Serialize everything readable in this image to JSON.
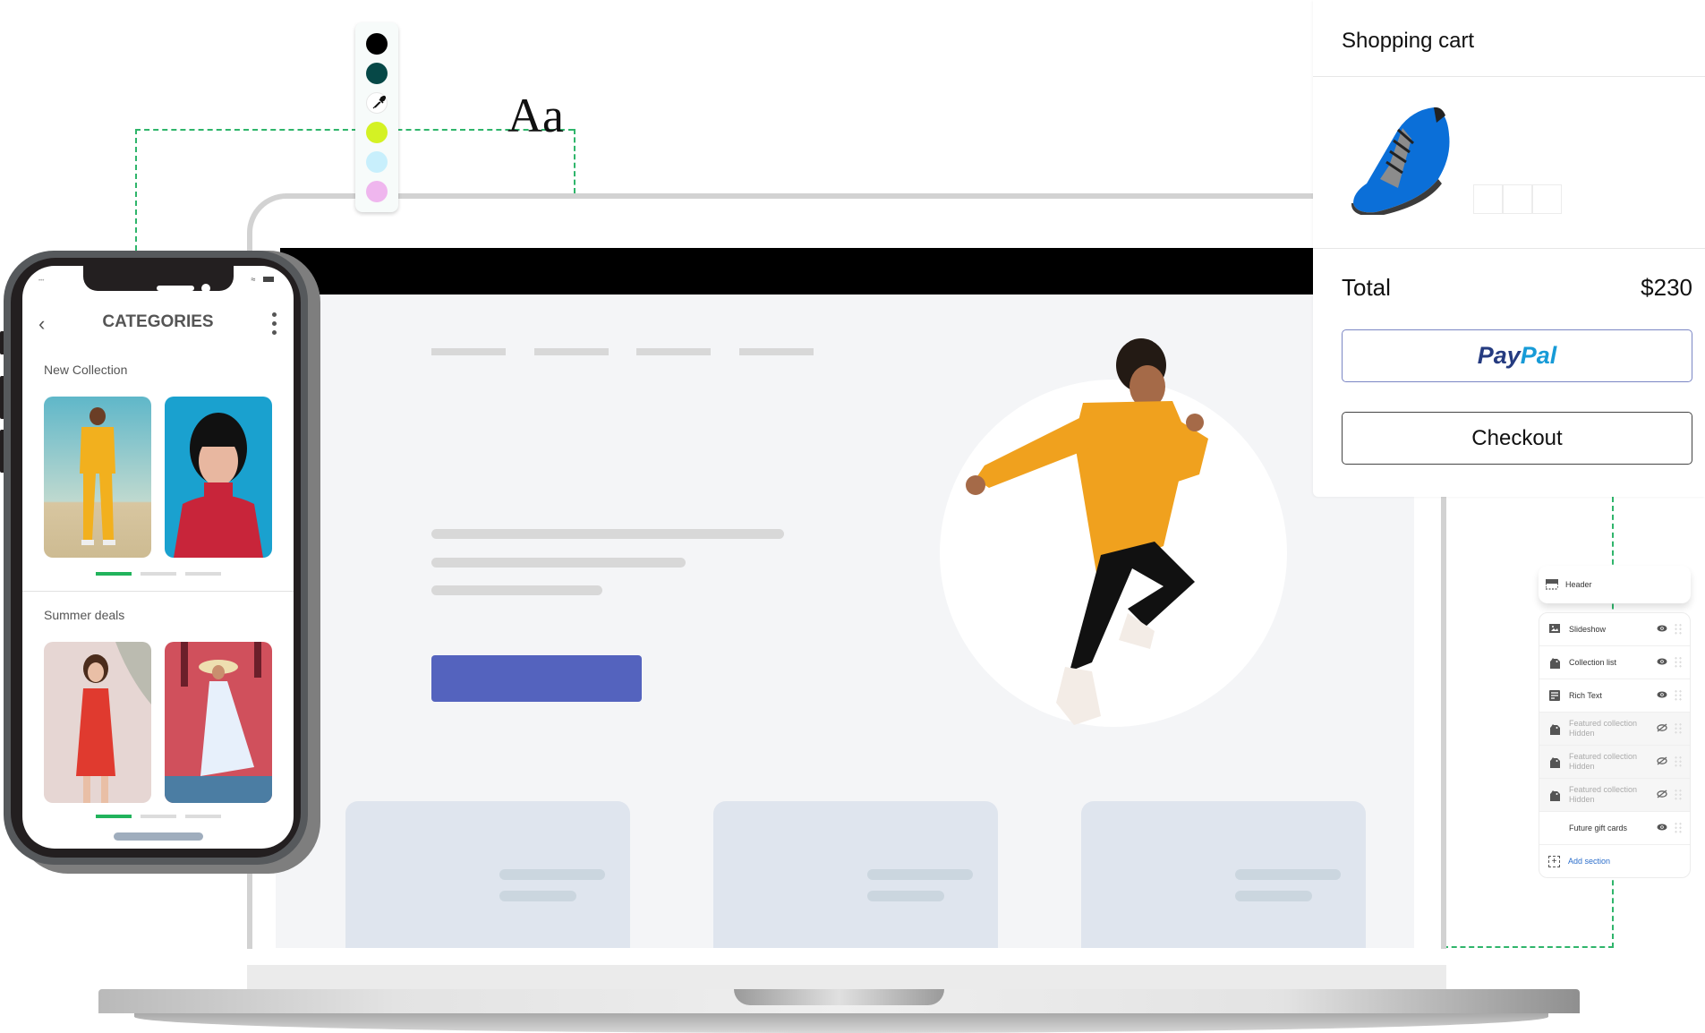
{
  "palette": {
    "colors": [
      "#000000",
      "#064847",
      "#ffffff",
      "#d4f224",
      "#c8effc",
      "#efb6ee"
    ],
    "eyedropper_icon": "eyedropper-icon",
    "typography_sample": "Aa"
  },
  "phone": {
    "title": "CATEGORIES",
    "back_icon": "chevron-left-icon",
    "more_icon": "more-vertical-icon",
    "status_icons": [
      "wifi-icon",
      "battery-icon"
    ],
    "sections": [
      {
        "label": "New Collection",
        "images": [
          "woman-yellow-tracksuit",
          "woman-red-sweater"
        ],
        "active_page": 1,
        "pages": 3
      },
      {
        "label": "Summer deals",
        "images": [
          "woman-red-floral-dress",
          "woman-white-dress-hat"
        ],
        "active_page": 1,
        "pages": 3
      }
    ]
  },
  "storefront": {
    "nav_placeholders": 4,
    "text_placeholders": 3,
    "cta_color": "#5463be",
    "product_cards": 3,
    "hero_image": "jumping-man-orange-sweater"
  },
  "cart": {
    "title": "Shopping cart",
    "item_image": "blue-running-shoe",
    "total_label": "Total",
    "total_value": "$230",
    "paypal_label_1": "Pay",
    "paypal_label_2": "Pal",
    "checkout_label": "Checkout"
  },
  "sections_panel": {
    "header": {
      "label": "Header",
      "icon": "header-layout-icon"
    },
    "items": [
      {
        "label": "Slideshow",
        "sub": "",
        "icon": "image-icon",
        "visible": true
      },
      {
        "label": "Collection list",
        "sub": "",
        "icon": "tags-icon",
        "visible": true
      },
      {
        "label": "Rich Text",
        "sub": "",
        "icon": "text-block-icon",
        "visible": true
      },
      {
        "label": "Featured collection",
        "sub": "Hidden",
        "icon": "tags-icon",
        "visible": false
      },
      {
        "label": "Featured collection",
        "sub": "Hidden",
        "icon": "tags-icon",
        "visible": false
      },
      {
        "label": "Featured collection",
        "sub": "Hidden",
        "icon": "tags-icon",
        "visible": false
      },
      {
        "label": "Future gift cards",
        "sub": "",
        "icon": "",
        "visible": true
      }
    ],
    "add_label": "Add section"
  },
  "accent_colors": {
    "connector": "#2fb56b",
    "paypal_dark": "#253b80",
    "paypal_light": "#179bd7",
    "link": "#2c6ecb"
  }
}
